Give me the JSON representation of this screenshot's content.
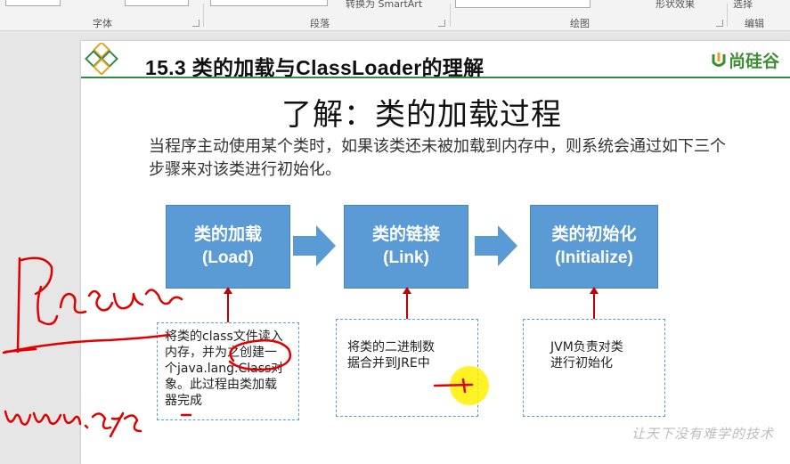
{
  "ribbon": {
    "groups": {
      "font": "字体",
      "paragraph": "段落",
      "drawing": "绘图",
      "editing": "编辑"
    },
    "convert_smartart": "转换为 SmartArt",
    "shape_effects": "形状效果",
    "select": "选择"
  },
  "slide": {
    "title": "15.3 类的加载与ClassLoader的理解",
    "brand": "尚硅谷",
    "heading": "了解：类的加载过程",
    "intro": "当程序主动使用某个类时，如果该类还未被加载到内存中，则系统会通过如下三个步骤来对该类进行初始化。",
    "steps": [
      {
        "zh": "类的加载",
        "en": "(Load)"
      },
      {
        "zh": "类的链接",
        "en": "(Link)"
      },
      {
        "zh": "类的初始化",
        "en": "(Initialize)"
      }
    ],
    "descriptions": [
      [
        "将类的class文件读入",
        "内存，并为之创建一",
        "个java.lang.Class对",
        "象。此过程由类加载",
        "器完成"
      ],
      [
        "将类的二进制数",
        "据合并到JRE中"
      ],
      [
        "JVM负责对类",
        "进行初始化"
      ]
    ],
    "watermark": "让天下没有难学的技术"
  },
  "colors": {
    "step_fill": "#5b9bd5",
    "header_line": "#2e8a45",
    "brand": "#3c8e33",
    "annotation_ink": "#c00000",
    "highlight": "#fff000"
  }
}
